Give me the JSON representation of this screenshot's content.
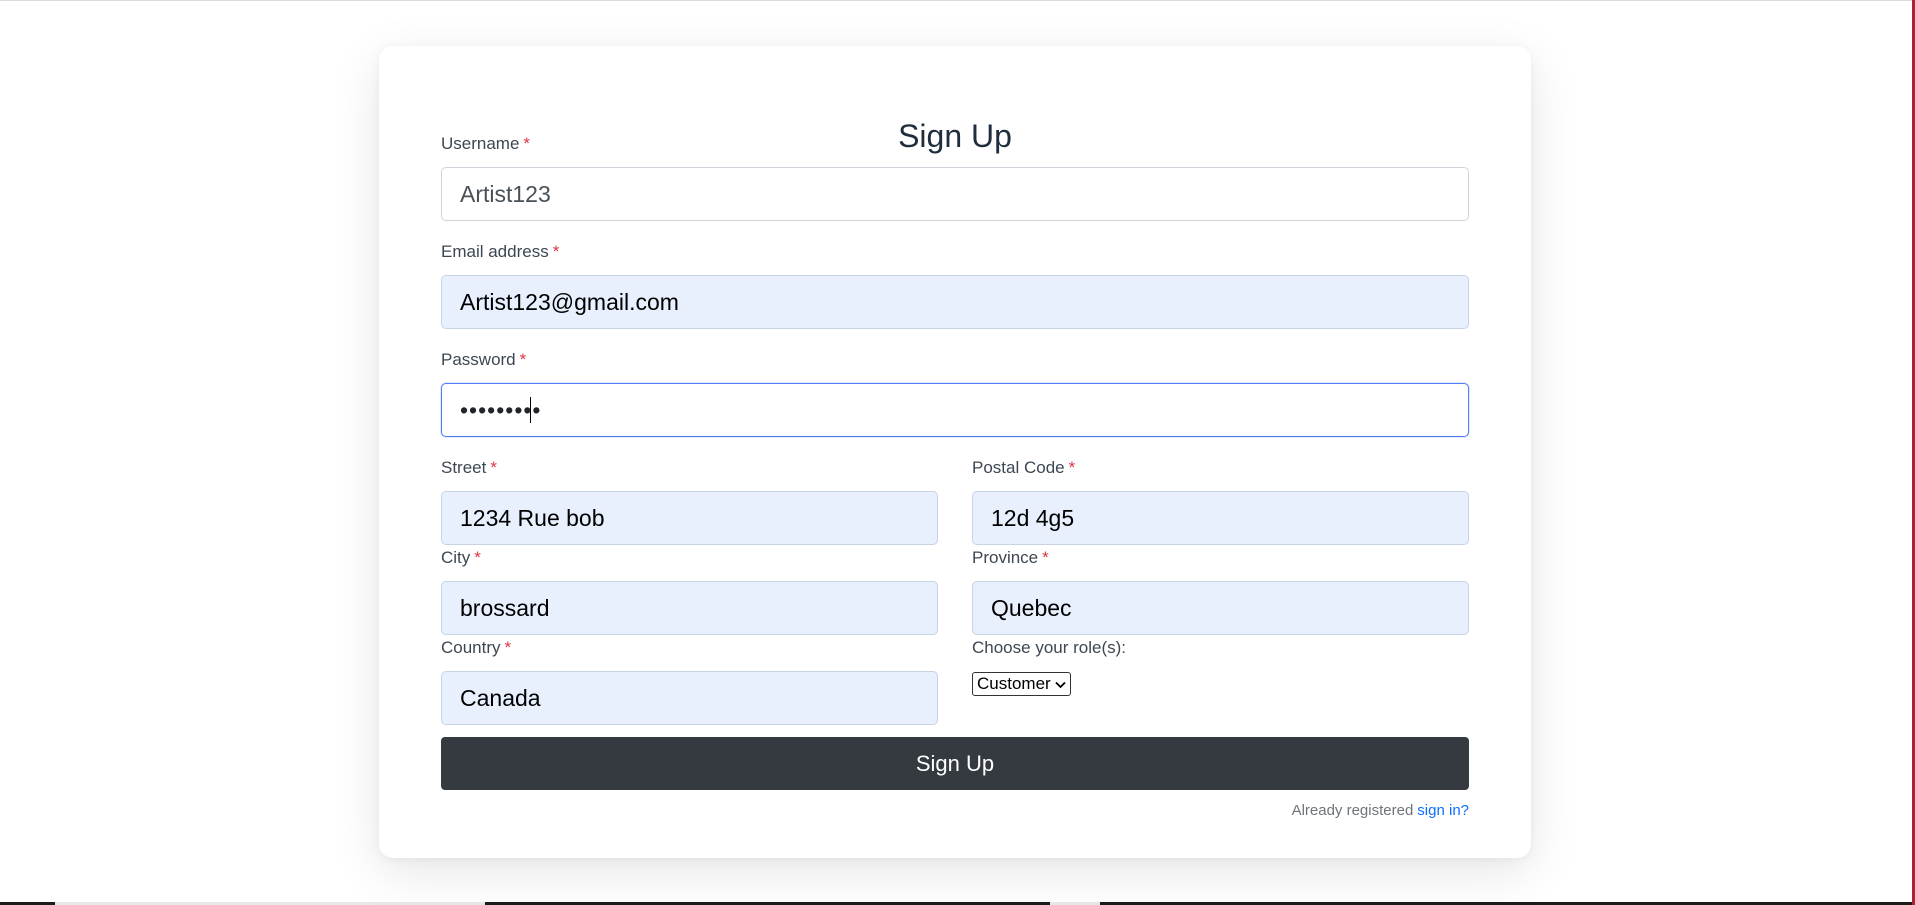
{
  "form": {
    "title": "Sign Up",
    "required_marker": "*",
    "fields": {
      "username": {
        "label": "Username",
        "value": "Artist123"
      },
      "email": {
        "label": "Email address",
        "value": "Artist123@gmail.com"
      },
      "password": {
        "label": "Password",
        "value": "•••••••••"
      },
      "street": {
        "label": "Street",
        "value": "1234 Rue bob"
      },
      "postal_code": {
        "label": "Postal Code",
        "value": "12d 4g5"
      },
      "city": {
        "label": "City",
        "value": "brossard"
      },
      "province": {
        "label": "Province",
        "value": "Quebec"
      },
      "country": {
        "label": "Country",
        "value": "Canada"
      }
    },
    "role": {
      "label": "Choose your role(s):",
      "selected": "Customer"
    },
    "submit_label": "Sign Up",
    "footer": {
      "text": "Already registered",
      "link": "sign in?"
    }
  },
  "colors": {
    "primary_button": "#343a40",
    "autofill_bg": "#e8f0fe",
    "required": "#dc3545",
    "link": "#0d6efd",
    "focus_border": "#4d7cf4"
  },
  "icons": {
    "select_chevron": "chevron-down-icon"
  }
}
